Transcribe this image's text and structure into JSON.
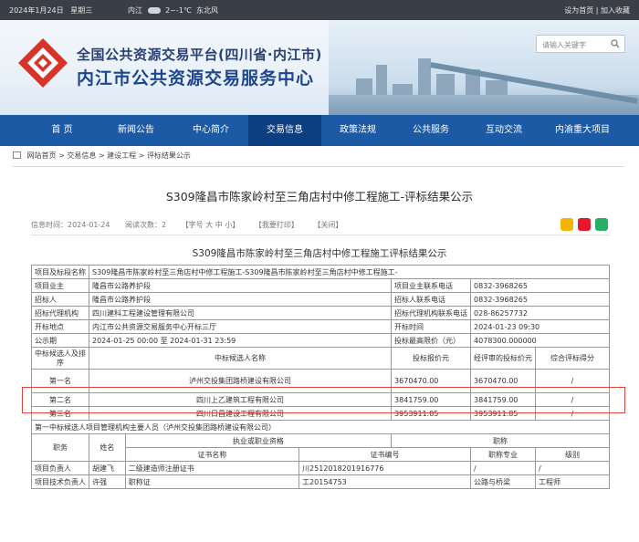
{
  "topbar": {
    "date": "2024年1月24日",
    "weekday": "星期三",
    "city": "内江",
    "temp": "2~-1℃",
    "wind": "东北风",
    "homepage_link": "设为首页",
    "separator": "|",
    "favorite_link": "加入收藏"
  },
  "header": {
    "title_line1": "全国公共资源交易平台(四川省·内江市)",
    "title_line2": "内江市公共资源交易服务中心",
    "search_placeholder": "请输入关键字"
  },
  "nav": {
    "items": [
      "首 页",
      "新闻公告",
      "中心简介",
      "交易信息",
      "政策法规",
      "公共服务",
      "互动交流",
      "内渝重大项目"
    ],
    "active_index": 3
  },
  "breadcrumb": {
    "items": [
      "网站首页",
      "交易信息",
      "建设工程",
      "评标结果公示"
    ],
    "separator": " > "
  },
  "article": {
    "title": "S309隆昌市陈家岭村至三角店村中修工程施工-评标结果公示",
    "publish_time": "信息时间：2024-01-24",
    "views": "阅读次数：2",
    "font_size": "【字号 大 中 小】",
    "print": "【我要打印】",
    "close": "【关闭】"
  },
  "table": {
    "title": "S309隆昌市陈家岭村至三角店村中修工程施工评标结果公示",
    "project_label": "项目及标段名称",
    "project_value": "S309隆昌市陈家岭村至三角店村中修工程施工-S309隆昌市陈家岭村至三角店村中修工程施工-",
    "owner_label": "项目业主",
    "owner_value": "隆昌市公路养护段",
    "owner_phone_label": "项目业主联系电话",
    "owner_phone_value": "0832-3968265",
    "tenderer_label": "招标人",
    "tenderer_value": "隆昌市公路养护段",
    "tenderer_phone_label": "招标人联系电话",
    "tenderer_phone_value": "0832-3968265",
    "agency_label": "招标代理机构",
    "agency_value": "四川建科工程建设管理有限公司",
    "agency_phone_label": "招标代理机构联系电话",
    "agency_phone_value": "028-86257732",
    "venue_label": "开标地点",
    "venue_value": "内江市公共资源交易服务中心开标三厅",
    "open_time_label": "开标时间",
    "open_time_value": "2024-01-23 09:30",
    "period_label": "公示期",
    "period_value": "2024-01-25 00:00 至 2024-01-31 23:59",
    "max_price_label": "投标最高限价（元）",
    "max_price_value": "4078300.000000",
    "cand_headers": [
      "中标候选人及排序",
      "中标候选人名称",
      "投标报价元",
      "经评审的投标价元",
      "综合评标得分"
    ],
    "candidates": [
      {
        "rank": "第一名",
        "name": "泸州交投集团路桥建设有限公司",
        "bid": "3670470.00",
        "evaluated": "3670470.00",
        "score": "/"
      },
      {
        "rank": "第二名",
        "name": "四川上乙建筑工程有限公司",
        "bid": "3841759.00",
        "evaluated": "3841759.00",
        "score": "/"
      },
      {
        "rank": "第三名",
        "name": "四川日昌建设工程有限公司",
        "bid": "3953911.85",
        "evaluated": "3953911.85",
        "score": "/"
      }
    ],
    "personnel_caption": "第一中标候选人项目管理机构主要人员（泸州交投集团路桥建设有限公司）",
    "pers_headers": {
      "role": "职务",
      "name": "姓名",
      "cert_group": "执业或职业资格",
      "title_group": "职称",
      "cert_name": "证书名称",
      "cert_no": "证书编号",
      "major": "职称专业",
      "level": "级别"
    },
    "personnel": [
      {
        "role": "项目负责人",
        "name": "胡建飞",
        "cert_name": "二级建造师注册证书",
        "cert_no": "川2512018201916776",
        "major": "/",
        "level": "/"
      },
      {
        "role": "项目技术负责人",
        "name": "许强",
        "cert_name": "职称证",
        "cert_no": "工20154753",
        "major": "公路与桥梁",
        "level": "工程师"
      }
    ]
  },
  "colors": {
    "nav_blue": "#1c5aa6",
    "nav_active": "#0c3f82",
    "highlight_red": "#e0463c",
    "topbar": "#3a3f47"
  }
}
